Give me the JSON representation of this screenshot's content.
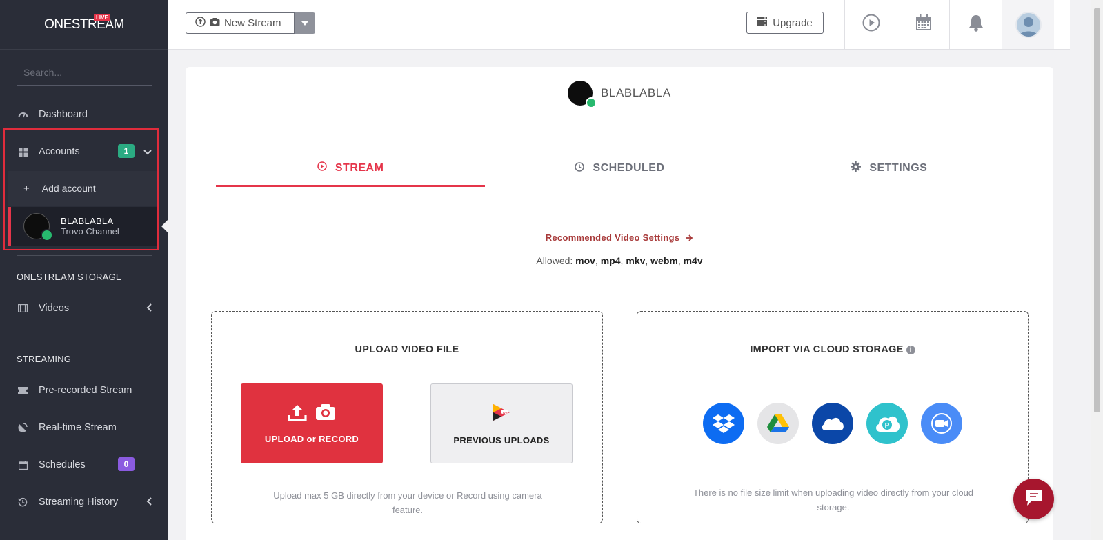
{
  "sidebar": {
    "logo_text": "ONESTREAM",
    "logo_badge": "LIVE",
    "search_placeholder": "Search...",
    "nav": {
      "dashboard": "Dashboard",
      "accounts": "Accounts",
      "accounts_badge": "1",
      "add_account": "Add account",
      "account_name": "BLABLABLA",
      "account_type": "Trovo Channel",
      "storage_title": "ONESTREAM STORAGE",
      "videos": "Videos",
      "streaming_title": "STREAMING",
      "prerecorded": "Pre-recorded Stream",
      "realtime": "Real-time Stream",
      "schedules": "Schedules",
      "schedules_badge": "0",
      "history": "Streaming History"
    }
  },
  "topbar": {
    "new_stream": "New Stream",
    "upgrade": "Upgrade"
  },
  "main": {
    "channel_name": "BLABLABLA",
    "tabs": [
      "STREAM",
      "SCHEDULED",
      "SETTINGS"
    ],
    "active_tab": "STREAM",
    "recommended": "Recommended Video Settings",
    "allowed_label": "Allowed:",
    "allowed_formats": [
      "mov",
      "mp4",
      "mkv",
      "webm",
      "m4v"
    ],
    "upload_panel": {
      "title": "UPLOAD VIDEO FILE",
      "upload_btn": "UPLOAD or RECORD",
      "prev_btn": "PREVIOUS UPLOADS",
      "note": "Upload max 5 GB directly from your device or Record using camera feature."
    },
    "cloud_panel": {
      "title": "IMPORT VIA CLOUD STORAGE",
      "services": [
        "dropbox-icon",
        "google-drive-icon",
        "onedrive-icon",
        "pcloud-icon",
        "zoom-icon"
      ],
      "note": "There is no file size limit when uploading video directly from your cloud storage."
    }
  },
  "colors": {
    "accent": "#e5354a",
    "sidebar_bg": "#2a2d38",
    "badge_green": "#2bab82",
    "badge_purple": "#8b5be0",
    "chat": "#a7162e"
  }
}
